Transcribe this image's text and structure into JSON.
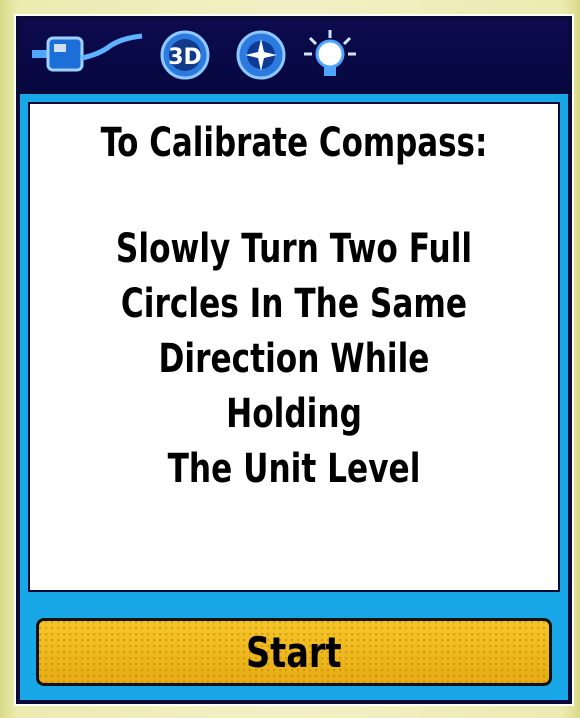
{
  "status_bar": {
    "icons": [
      "power-cord-icon",
      "3d-gps-fix-icon",
      "satellite-icon",
      "backlight-icon"
    ],
    "gps_fix_label": "3D"
  },
  "message": {
    "title": "To Calibrate Compass:",
    "body": "Slowly Turn Two Full\nCircles In The Same\nDirection While Holding\nThe Unit Level"
  },
  "start_button": {
    "label": "Start"
  },
  "colors": {
    "status_bar_bg": "#0b0b4e",
    "panel_border": "#18a8e8",
    "button_fill": "#f0bb20"
  }
}
